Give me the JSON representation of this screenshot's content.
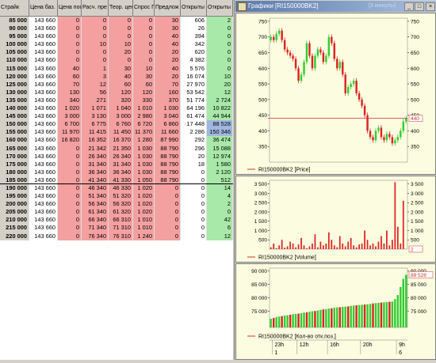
{
  "desk": {
    "columns": [
      "Страйк",
      "Цена баз.",
      "Цена пос",
      "Расч. пре",
      "Теор. цен",
      "Спрос Г",
      "Предлож",
      "Открыты",
      "Открыты"
    ],
    "rows": [
      {
        "strike": "85 000",
        "fut": "143 660",
        "last": "0",
        "calc": "0",
        "theor": "0",
        "bid": "0",
        "ask": "30",
        "oi": "606",
        "chg": "2"
      },
      {
        "strike": "90 000",
        "fut": "143 660",
        "last": "0",
        "calc": "0",
        "theor": "0",
        "bid": "0",
        "ask": "30",
        "oi": "26",
        "chg": "0"
      },
      {
        "strike": "95 000",
        "fut": "143 660",
        "last": "0",
        "calc": "0",
        "theor": "0",
        "bid": "0",
        "ask": "40",
        "oi": "394",
        "chg": "0"
      },
      {
        "strike": "100 000",
        "fut": "143 660",
        "last": "0",
        "calc": "10",
        "theor": "10",
        "bid": "0",
        "ask": "40",
        "oi": "342",
        "chg": "0"
      },
      {
        "strike": "105 000",
        "fut": "143 660",
        "last": "0",
        "calc": "0",
        "theor": "20",
        "bid": "0",
        "ask": "20",
        "oi": "620",
        "chg": "0"
      },
      {
        "strike": "110 000",
        "fut": "143 660",
        "last": "0",
        "calc": "0",
        "theor": "0",
        "bid": "0",
        "ask": "20",
        "oi": "4 382",
        "chg": "0"
      },
      {
        "strike": "115 000",
        "fut": "143 660",
        "last": "40",
        "calc": "1",
        "theor": "30",
        "bid": "10",
        "ask": "40",
        "oi": "5 576",
        "chg": "0"
      },
      {
        "strike": "120 000",
        "fut": "143 660",
        "last": "60",
        "calc": "3",
        "theor": "40",
        "bid": "30",
        "ask": "20",
        "oi": "16 074",
        "chg": "10"
      },
      {
        "strike": "125 000",
        "fut": "143 660",
        "last": "70",
        "calc": "12",
        "theor": "60",
        "bid": "60",
        "ask": "70",
        "oi": "27 970",
        "chg": "20"
      },
      {
        "strike": "130 000",
        "fut": "143 660",
        "last": "130",
        "calc": "56",
        "theor": "120",
        "bid": "120",
        "ask": "160",
        "oi": "53 542",
        "chg": "12"
      },
      {
        "strike": "135 000",
        "fut": "143 660",
        "last": "340",
        "calc": "271",
        "theor": "320",
        "bid": "330",
        "ask": "370",
        "oi": "51 774",
        "chg": "2 724"
      },
      {
        "strike": "140 000",
        "fut": "143 660",
        "last": "1 020",
        "calc": "1 071",
        "theor": "1 040",
        "bid": "1 010",
        "ask": "1 030",
        "oi": "64 196",
        "chg": "10 822"
      },
      {
        "strike": "145 000",
        "fut": "143 660",
        "last": "3 000",
        "calc": "3 130",
        "theor": "3 000",
        "bid": "2 980",
        "ask": "3 040",
        "oi": "61 474",
        "chg": "44 944"
      },
      {
        "strike": "150 000",
        "fut": "143 660",
        "last": "6 700",
        "calc": "6 775",
        "theor": "6 760",
        "bid": "6 720",
        "ask": "6 860",
        "oi": "17 448",
        "chg": "88 528"
      },
      {
        "strike": "155 000",
        "fut": "143 660",
        "last": "11 970",
        "calc": "11 415",
        "theor": "11 450",
        "bid": "11 370",
        "ask": "11 660",
        "oi": "2 286",
        "chg": "150 346"
      },
      {
        "strike": "160 000",
        "fut": "143 660",
        "last": "16 820",
        "calc": "16 352",
        "theor": "16 370",
        "bid": "1 280",
        "ask": "87 990",
        "oi": "292",
        "chg": "36 474"
      },
      {
        "strike": "165 000",
        "fut": "143 660",
        "last": "0",
        "calc": "21 342",
        "theor": "21 350",
        "bid": "1 030",
        "ask": "88 790",
        "oi": "296",
        "chg": "15 088"
      },
      {
        "strike": "170 000",
        "fut": "143 660",
        "last": "0",
        "calc": "26 340",
        "theor": "26 340",
        "bid": "1 030",
        "ask": "88 790",
        "oi": "20",
        "chg": "12 974"
      },
      {
        "strike": "175 000",
        "fut": "143 660",
        "last": "0",
        "calc": "31 340",
        "theor": "31 340",
        "bid": "1 030",
        "ask": "88 790",
        "oi": "18",
        "chg": "1 580"
      },
      {
        "strike": "180 000",
        "fut": "143 660",
        "last": "0",
        "calc": "36 340",
        "theor": "36 340",
        "bid": "1 030",
        "ask": "88 790",
        "oi": "0",
        "chg": "2 120"
      },
      {
        "strike": "185 000",
        "fut": "143 660",
        "last": "0",
        "calc": "41 340",
        "theor": "41 330",
        "bid": "1 050",
        "ask": "88 790",
        "oi": "0",
        "chg": "512"
      },
      {
        "strike": "190 000",
        "fut": "143 660",
        "last": "0",
        "calc": "46 340",
        "theor": "46 330",
        "bid": "1 020",
        "ask": "0",
        "oi": "0",
        "chg": "14"
      },
      {
        "strike": "195 000",
        "fut": "143 660",
        "last": "0",
        "calc": "51 340",
        "theor": "51 320",
        "bid": "1 020",
        "ask": "0",
        "oi": "0",
        "chg": "4"
      },
      {
        "strike": "200 000",
        "fut": "143 660",
        "last": "0",
        "calc": "56 340",
        "theor": "56 320",
        "bid": "1 020",
        "ask": "0",
        "oi": "0",
        "chg": "2"
      },
      {
        "strike": "205 000",
        "fut": "143 660",
        "last": "0",
        "calc": "61 340",
        "theor": "61 320",
        "bid": "1 020",
        "ask": "0",
        "oi": "0",
        "chg": "0"
      },
      {
        "strike": "210 000",
        "fut": "143 660",
        "last": "0",
        "calc": "66 340",
        "theor": "66 310",
        "bid": "1 010",
        "ask": "0",
        "oi": "0",
        "chg": "42"
      },
      {
        "strike": "215 000",
        "fut": "143 660",
        "last": "0",
        "calc": "71 340",
        "theor": "71 310",
        "bid": "1 010",
        "ask": "0",
        "oi": "0",
        "chg": "6"
      },
      {
        "strike": "220 000",
        "fut": "143 660",
        "last": "0",
        "calc": "76 340",
        "theor": "76 310",
        "bid": "1 240",
        "ask": "0",
        "oi": "0",
        "chg": "12"
      }
    ]
  },
  "window": {
    "title": "Графики [RI150000BK2]",
    "title_suffix": "[3 минуты]",
    "min": "_",
    "max": "□",
    "close": "×"
  },
  "colors": {
    "up": "#33cc33",
    "down": "#dd2222",
    "price_line": "#cc3333",
    "panel_bg": "#fcfce0"
  },
  "chart_data": [
    {
      "type": "candlestick",
      "series_label": "RI150000BK2 [Price]",
      "ylim": [
        300,
        760
      ],
      "yticks": [
        350,
        400,
        450,
        500,
        550,
        600,
        650,
        700,
        750
      ],
      "last_value": "440",
      "last": 440,
      "closes": [
        700,
        690,
        710,
        720,
        690,
        660,
        650,
        640,
        630,
        600,
        560,
        580,
        620,
        680,
        640,
        600,
        640,
        660,
        650,
        620,
        640,
        700,
        680,
        630,
        600,
        620,
        580,
        520,
        540,
        550,
        560,
        520,
        500,
        480,
        450,
        400,
        380,
        370,
        400,
        410,
        380,
        370,
        390,
        380,
        360,
        370,
        380,
        400,
        430,
        440
      ],
      "opens": [
        690,
        700,
        690,
        710,
        720,
        690,
        660,
        650,
        640,
        630,
        600,
        560,
        580,
        620,
        680,
        640,
        600,
        640,
        660,
        650,
        620,
        640,
        700,
        680,
        630,
        600,
        620,
        580,
        520,
        540,
        550,
        560,
        520,
        500,
        480,
        450,
        400,
        380,
        370,
        400,
        410,
        380,
        370,
        390,
        380,
        360,
        370,
        380,
        400,
        430
      ]
    },
    {
      "type": "bar",
      "series_label": "RI150000BK2 [Volume]",
      "ylim": [
        0,
        3700
      ],
      "yticks": [
        500,
        1000,
        1500,
        2000,
        2500,
        3000,
        3500
      ],
      "last_value": "2",
      "values": [
        100,
        300,
        50,
        200,
        500,
        80,
        150,
        400,
        300,
        100,
        250,
        600,
        200,
        50,
        150,
        300,
        800,
        100,
        400,
        200,
        300,
        900,
        500,
        200,
        100,
        700,
        300,
        150,
        400,
        600,
        200,
        100,
        250,
        300,
        1000,
        500,
        200,
        300,
        150,
        400,
        700,
        300,
        1000,
        200,
        500,
        3600,
        1200,
        300,
        2600,
        0
      ]
    },
    {
      "type": "bar",
      "series_label": "RI150000BK2 [Кол-во отк.поз.]",
      "ylim": [
        69000,
        91000
      ],
      "yticks": [
        75000,
        80000,
        85000,
        90000
      ],
      "last_value": "88 528",
      "x_ticks": [
        "23h",
        "12h",
        "16h",
        "20h",
        "9h"
      ],
      "x_ticks_bottom": [
        "1",
        "6"
      ],
      "values": [
        72200,
        72500,
        72800,
        73000,
        73200,
        73400,
        73500,
        73700,
        73900,
        74000,
        74100,
        74300,
        74500,
        74600,
        74800,
        75000,
        75100,
        75300,
        75500,
        75700,
        75800,
        76000,
        76100,
        76300,
        76400,
        76500,
        76600,
        76700,
        76800,
        77000,
        77100,
        77200,
        77300,
        77400,
        77500,
        77600,
        77700,
        77900,
        78000,
        78100,
        78200,
        78300,
        78400,
        78500,
        78600,
        79500,
        81000,
        84000,
        87000,
        88528
      ]
    }
  ]
}
